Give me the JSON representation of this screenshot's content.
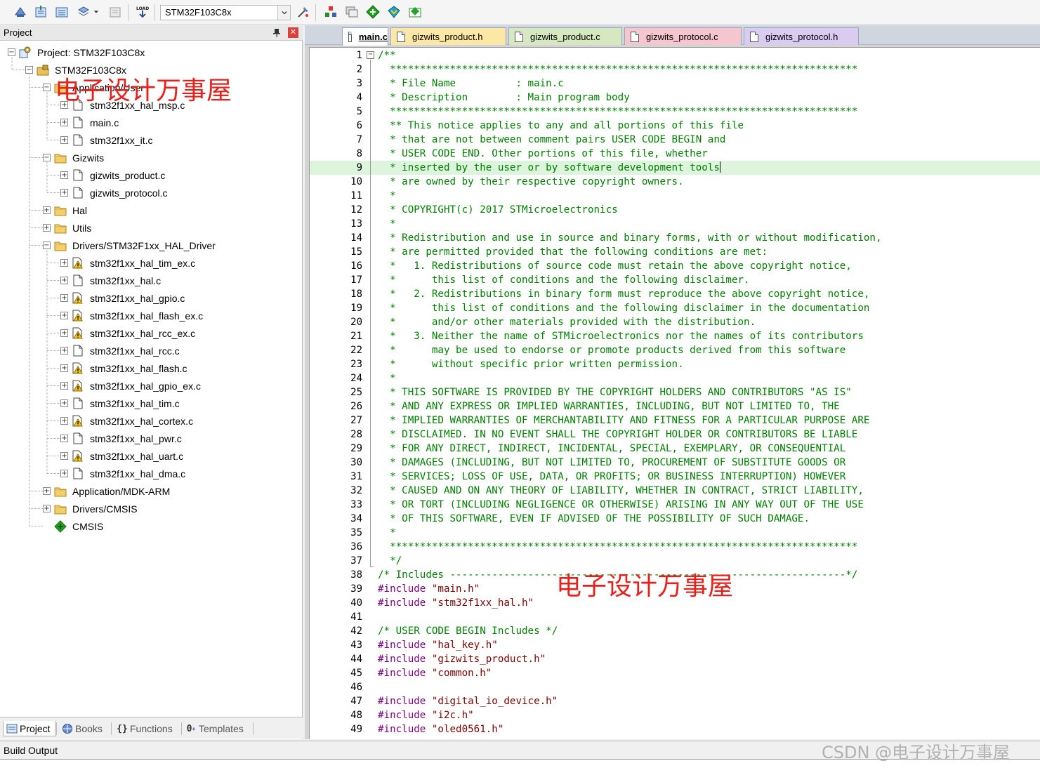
{
  "toolbar": {
    "target": "STM32F103C8x",
    "load_label": "LOAD"
  },
  "project_panel": {
    "title": "Project",
    "tree": [
      {
        "label": "Project: STM32F103C8x",
        "depth": 0,
        "expander": "-",
        "icon": "project-gear-icon"
      },
      {
        "label": "STM32F103C8x",
        "depth": 1,
        "expander": "-",
        "icon": "target-folder-icon"
      },
      {
        "label": "Application/User",
        "depth": 2,
        "expander": "-",
        "icon": "folder-icon"
      },
      {
        "label": "stm32f1xx_hal_msp.c",
        "depth": 3,
        "expander": "+",
        "icon": "file-icon"
      },
      {
        "label": "main.c",
        "depth": 3,
        "expander": "+",
        "icon": "file-icon"
      },
      {
        "label": "stm32f1xx_it.c",
        "depth": 3,
        "expander": "+",
        "icon": "file-icon"
      },
      {
        "label": "Gizwits",
        "depth": 2,
        "expander": "-",
        "icon": "folder-icon"
      },
      {
        "label": "gizwits_product.c",
        "depth": 3,
        "expander": "+",
        "icon": "file-icon"
      },
      {
        "label": "gizwits_protocol.c",
        "depth": 3,
        "expander": "+",
        "icon": "file-icon"
      },
      {
        "label": "Hal",
        "depth": 2,
        "expander": "+",
        "icon": "folder-icon"
      },
      {
        "label": "Utils",
        "depth": 2,
        "expander": "+",
        "icon": "folder-icon"
      },
      {
        "label": "Drivers/STM32F1xx_HAL_Driver",
        "depth": 2,
        "expander": "-",
        "icon": "folder-icon"
      },
      {
        "label": "stm32f1xx_hal_tim_ex.c",
        "depth": 3,
        "expander": "+",
        "icon": "warning-file-icon"
      },
      {
        "label": "stm32f1xx_hal.c",
        "depth": 3,
        "expander": "+",
        "icon": "file-icon"
      },
      {
        "label": "stm32f1xx_hal_gpio.c",
        "depth": 3,
        "expander": "+",
        "icon": "warning-file-icon"
      },
      {
        "label": "stm32f1xx_hal_flash_ex.c",
        "depth": 3,
        "expander": "+",
        "icon": "warning-file-icon"
      },
      {
        "label": "stm32f1xx_hal_rcc_ex.c",
        "depth": 3,
        "expander": "+",
        "icon": "warning-file-icon"
      },
      {
        "label": "stm32f1xx_hal_rcc.c",
        "depth": 3,
        "expander": "+",
        "icon": "file-icon"
      },
      {
        "label": "stm32f1xx_hal_flash.c",
        "depth": 3,
        "expander": "+",
        "icon": "warning-file-icon"
      },
      {
        "label": "stm32f1xx_hal_gpio_ex.c",
        "depth": 3,
        "expander": "+",
        "icon": "warning-file-icon"
      },
      {
        "label": "stm32f1xx_hal_tim.c",
        "depth": 3,
        "expander": "+",
        "icon": "file-icon"
      },
      {
        "label": "stm32f1xx_hal_cortex.c",
        "depth": 3,
        "expander": "+",
        "icon": "warning-file-icon"
      },
      {
        "label": "stm32f1xx_hal_pwr.c",
        "depth": 3,
        "expander": "+",
        "icon": "file-icon"
      },
      {
        "label": "stm32f1xx_hal_uart.c",
        "depth": 3,
        "expander": "+",
        "icon": "warning-file-icon"
      },
      {
        "label": "stm32f1xx_hal_dma.c",
        "depth": 3,
        "expander": "+",
        "icon": "file-icon"
      },
      {
        "label": "Application/MDK-ARM",
        "depth": 2,
        "expander": "+",
        "icon": "folder-icon"
      },
      {
        "label": "Drivers/CMSIS",
        "depth": 2,
        "expander": "+",
        "icon": "folder-icon"
      },
      {
        "label": "CMSIS",
        "depth": 2,
        "expander": "",
        "icon": "green-diamond-icon"
      }
    ],
    "bottom_tabs": [
      {
        "label": "Project",
        "icon": "project-icon",
        "active": true
      },
      {
        "label": "Books",
        "icon": "books-icon",
        "active": false
      },
      {
        "label": "Functions",
        "icon": "braces-icon",
        "active": false
      },
      {
        "label": "Templates",
        "icon": "templates-icon",
        "active": false
      }
    ]
  },
  "editor": {
    "tabs": [
      {
        "label": "main.c",
        "active": true,
        "color": "#ffffff"
      },
      {
        "label": "gizwits_product.h",
        "active": false,
        "color": "#fce8a6"
      },
      {
        "label": "gizwits_product.c",
        "active": false,
        "color": "#d6e8c0"
      },
      {
        "label": "gizwits_protocol.c",
        "active": false,
        "color": "#f5c6cf"
      },
      {
        "label": "gizwits_protocol.h",
        "active": false,
        "color": "#d9ccf0"
      }
    ],
    "highlight_line": 9,
    "lines": [
      {
        "n": "1",
        "t": "/**"
      },
      {
        "n": "2",
        "t": "  ******************************************************************************"
      },
      {
        "n": "3",
        "t": "  * File Name          : main.c"
      },
      {
        "n": "4",
        "t": "  * Description        : Main program body"
      },
      {
        "n": "5",
        "t": "  ******************************************************************************"
      },
      {
        "n": "6",
        "t": "  ** This notice applies to any and all portions of this file"
      },
      {
        "n": "7",
        "t": "  * that are not between comment pairs USER CODE BEGIN and"
      },
      {
        "n": "8",
        "t": "  * USER CODE END. Other portions of this file, whether"
      },
      {
        "n": "9",
        "t": "  * inserted by the user or by software development tools"
      },
      {
        "n": "10",
        "t": "  * are owned by their respective copyright owners."
      },
      {
        "n": "11",
        "t": "  *"
      },
      {
        "n": "12",
        "t": "  * COPYRIGHT(c) 2017 STMicroelectronics"
      },
      {
        "n": "13",
        "t": "  *"
      },
      {
        "n": "14",
        "t": "  * Redistribution and use in source and binary forms, with or without modification,"
      },
      {
        "n": "15",
        "t": "  * are permitted provided that the following conditions are met:"
      },
      {
        "n": "16",
        "t": "  *   1. Redistributions of source code must retain the above copyright notice,"
      },
      {
        "n": "17",
        "t": "  *      this list of conditions and the following disclaimer."
      },
      {
        "n": "18",
        "t": "  *   2. Redistributions in binary form must reproduce the above copyright notice,"
      },
      {
        "n": "19",
        "t": "  *      this list of conditions and the following disclaimer in the documentation"
      },
      {
        "n": "20",
        "t": "  *      and/or other materials provided with the distribution."
      },
      {
        "n": "21",
        "t": "  *   3. Neither the name of STMicroelectronics nor the names of its contributors"
      },
      {
        "n": "22",
        "t": "  *      may be used to endorse or promote products derived from this software"
      },
      {
        "n": "23",
        "t": "  *      without specific prior written permission."
      },
      {
        "n": "24",
        "t": "  *"
      },
      {
        "n": "25",
        "t": "  * THIS SOFTWARE IS PROVIDED BY THE COPYRIGHT HOLDERS AND CONTRIBUTORS \"AS IS\""
      },
      {
        "n": "26",
        "t": "  * AND ANY EXPRESS OR IMPLIED WARRANTIES, INCLUDING, BUT NOT LIMITED TO, THE"
      },
      {
        "n": "27",
        "t": "  * IMPLIED WARRANTIES OF MERCHANTABILITY AND FITNESS FOR A PARTICULAR PURPOSE ARE"
      },
      {
        "n": "28",
        "t": "  * DISCLAIMED. IN NO EVENT SHALL THE COPYRIGHT HOLDER OR CONTRIBUTORS BE LIABLE"
      },
      {
        "n": "29",
        "t": "  * FOR ANY DIRECT, INDIRECT, INCIDENTAL, SPECIAL, EXEMPLARY, OR CONSEQUENTIAL"
      },
      {
        "n": "30",
        "t": "  * DAMAGES (INCLUDING, BUT NOT LIMITED TO, PROCUREMENT OF SUBSTITUTE GOODS OR"
      },
      {
        "n": "31",
        "t": "  * SERVICES; LOSS OF USE, DATA, OR PROFITS; OR BUSINESS INTERRUPTION) HOWEVER"
      },
      {
        "n": "32",
        "t": "  * CAUSED AND ON ANY THEORY OF LIABILITY, WHETHER IN CONTRACT, STRICT LIABILITY,"
      },
      {
        "n": "33",
        "t": "  * OR TORT (INCLUDING NEGLIGENCE OR OTHERWISE) ARISING IN ANY WAY OUT OF THE USE"
      },
      {
        "n": "34",
        "t": "  * OF THIS SOFTWARE, EVEN IF ADVISED OF THE POSSIBILITY OF SUCH DAMAGE."
      },
      {
        "n": "35",
        "t": "  *"
      },
      {
        "n": "36",
        "t": "  ******************************************************************************"
      },
      {
        "n": "37",
        "t": "  */"
      },
      {
        "n": "38",
        "t": "/* Includes ------------------------------------------------------------------*/"
      },
      {
        "n": "39",
        "t": "#include \"main.h\"",
        "pp": true
      },
      {
        "n": "40",
        "t": "#include \"stm32f1xx_hal.h\"",
        "pp": true
      },
      {
        "n": "41",
        "t": ""
      },
      {
        "n": "42",
        "t": "/* USER CODE BEGIN Includes */"
      },
      {
        "n": "43",
        "t": "#include \"hal_key.h\"",
        "pp": true
      },
      {
        "n": "44",
        "t": "#include \"gizwits_product.h\"",
        "pp": true
      },
      {
        "n": "45",
        "t": "#include \"common.h\"",
        "pp": true
      },
      {
        "n": "46",
        "t": ""
      },
      {
        "n": "47",
        "t": "#include \"digital_io_device.h\"",
        "pp": true
      },
      {
        "n": "48",
        "t": "#include \"i2c.h\"",
        "pp": true
      },
      {
        "n": "49",
        "t": "#include \"oled0561.h\"",
        "pp": true
      }
    ]
  },
  "build_output": {
    "title": "Build Output"
  },
  "watermarks": {
    "overlay_text": "电子设计万事屋",
    "csdn": "CSDN @电子设计万事屋"
  }
}
